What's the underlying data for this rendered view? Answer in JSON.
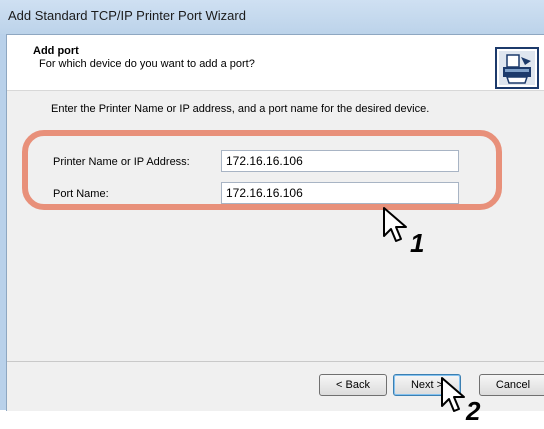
{
  "window": {
    "title": "Add Standard TCP/IP Printer Port Wizard"
  },
  "header": {
    "title": "Add port",
    "subtitle": "For which device do you want to add a port?",
    "icon": "printer-port-icon"
  },
  "instruction": "Enter the Printer Name or IP address, and a port name for the desired device.",
  "fields": {
    "printer_name_label": "Printer Name or IP Address:",
    "printer_name_value": "172.16.16.106",
    "port_name_label": "Port Name:",
    "port_name_value": "172.16.16.106"
  },
  "buttons": {
    "back": "< Back",
    "next": "Next >",
    "cancel": "Cancel"
  },
  "annotations": {
    "step1": "1",
    "step2": "2",
    "highlight_color": "#e8907a"
  }
}
